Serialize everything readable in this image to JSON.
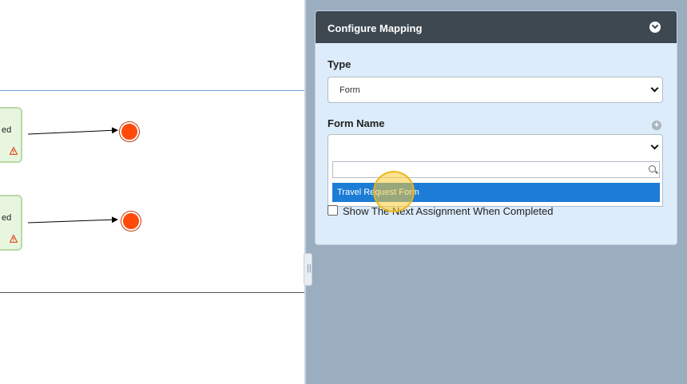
{
  "diagram": {
    "nodes": [
      {
        "label": "ed"
      },
      {
        "label": "ed"
      }
    ],
    "colors": {
      "end_event": "#ff4a0a",
      "lane_line": "#6aa7e0"
    }
  },
  "panel": {
    "title": "Configure Mapping",
    "type_label": "Type",
    "type_value": "Form",
    "form_name_label": "Form Name",
    "form_name_value": "",
    "search_placeholder": "",
    "options": [
      "Travel Request Form"
    ],
    "checkbox_label": "Show The Next Assignment When Completed",
    "accent_color": "#1c7cd6"
  }
}
